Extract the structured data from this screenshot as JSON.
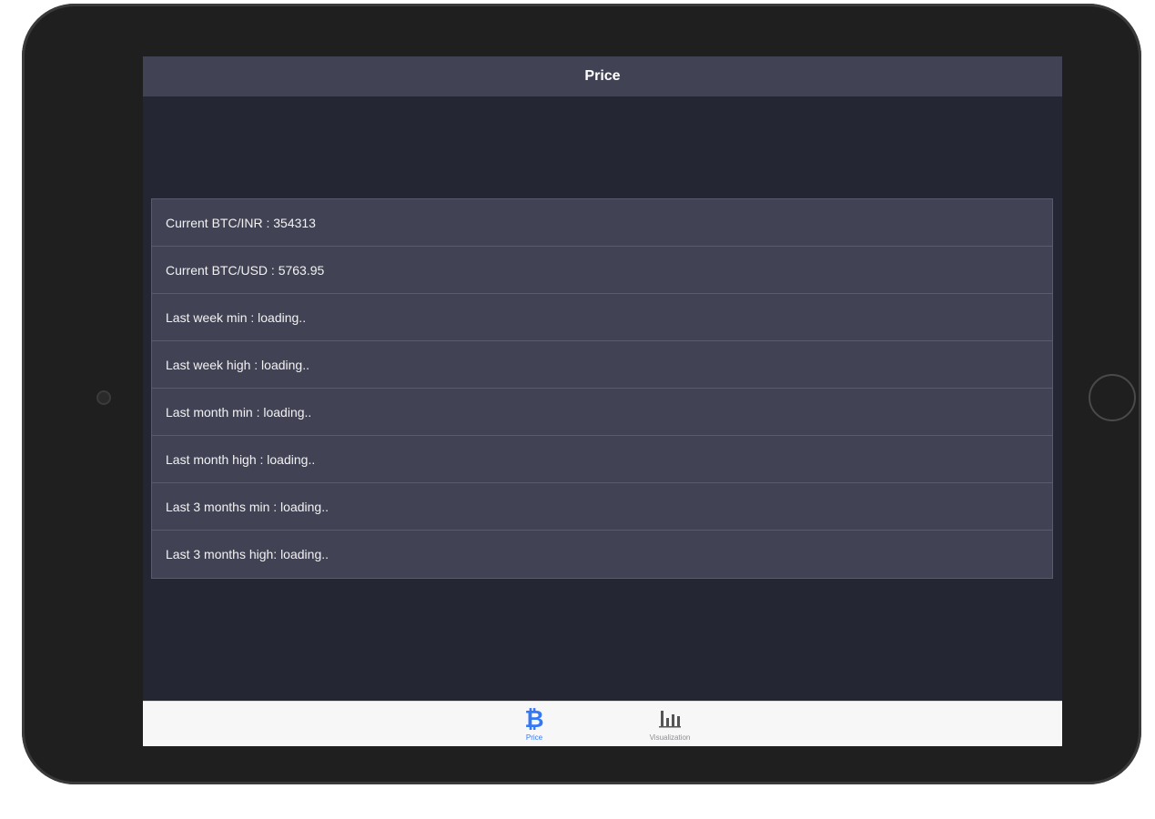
{
  "nav": {
    "title": "Price"
  },
  "rows": [
    {
      "text": "Current BTC/INR : 354313"
    },
    {
      "text": "Current BTC/USD : 5763.95"
    },
    {
      "text": "Last week min : loading.."
    },
    {
      "text": "Last week high : loading.."
    },
    {
      "text": "Last month min : loading.."
    },
    {
      "text": "Last month high : loading.."
    },
    {
      "text": "Last 3 months min : loading.."
    },
    {
      "text": "Last 3 months high: loading.."
    }
  ],
  "tab_bar": {
    "tabs": [
      {
        "label": "Price",
        "icon": "bitcoin-icon",
        "active": true
      },
      {
        "label": "Visualization",
        "icon": "bar-chart-icon",
        "active": false
      }
    ]
  },
  "colors": {
    "screen_bg": "#242733",
    "bar_bg": "#414354",
    "active_tab": "#3478f6",
    "inactive_tab": "#8e8e93",
    "device_frame": "#1f1f1f"
  }
}
